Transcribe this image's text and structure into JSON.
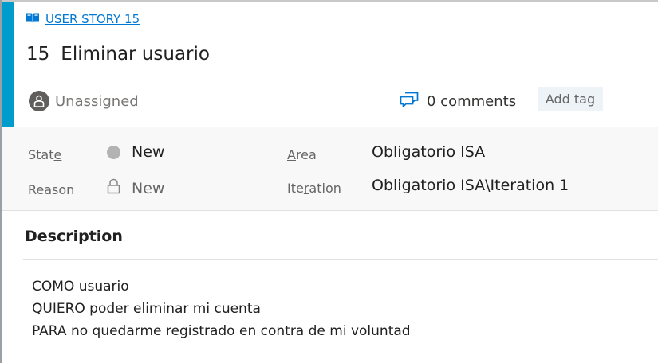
{
  "work_item": {
    "type_label": "USER STORY 15",
    "id": "15",
    "title": "Eliminar usuario",
    "assigned_to": "Unassigned",
    "comments_label": "0 comments",
    "add_tag_label": "Add tag"
  },
  "fields": {
    "state_label_pre": "Stat",
    "state_label_key": "e",
    "state_value": "New",
    "reason_label": "Reason",
    "reason_value": "New",
    "area_label_key": "A",
    "area_label_post": "rea",
    "area_value": "Obligatorio ISA",
    "iteration_label_pre": "Ite",
    "iteration_label_key": "r",
    "iteration_label_post": "ation",
    "iteration_value": "Obligatorio ISA\\Iteration 1"
  },
  "description": {
    "heading": "Description",
    "lines": [
      "COMO usuario",
      "QUIERO poder eliminar mi cuenta",
      "PARA no quedarme registrado en contra de mi voluntad"
    ]
  },
  "colors": {
    "accent": "#009ccc",
    "link": "#0078d4",
    "state_dot": "#b3b3b3"
  }
}
